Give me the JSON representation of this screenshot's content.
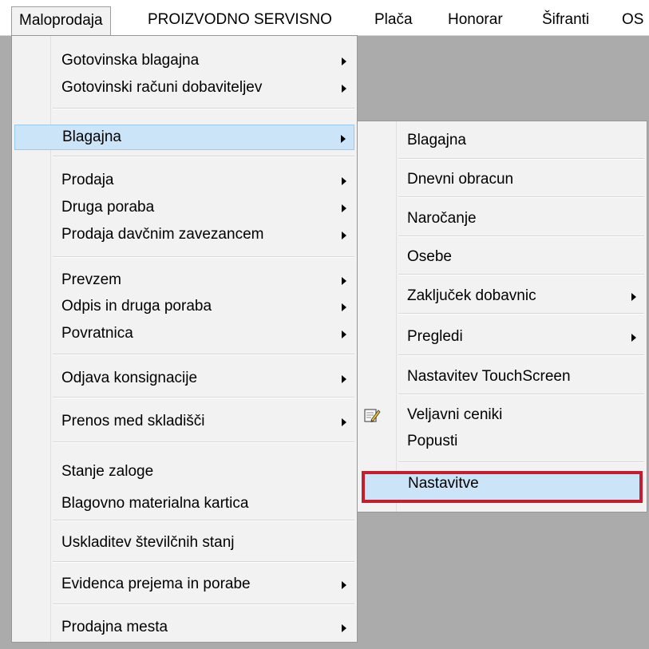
{
  "menubar": {
    "items": [
      {
        "label": "Maloprodaja"
      },
      {
        "label": "PROIZVODNO SERVISNO"
      },
      {
        "label": "Plača"
      },
      {
        "label": "Honorar"
      },
      {
        "label": "Šifranti"
      },
      {
        "label": "OS"
      }
    ]
  },
  "main_menu": {
    "items": [
      {
        "label": "Gotovinska blagajna"
      },
      {
        "label": "Gotovinski računi dobaviteljev"
      },
      {
        "label": "Blagajna"
      },
      {
        "label": "Prodaja"
      },
      {
        "label": "Druga poraba"
      },
      {
        "label": "Prodaja davčnim zavezancem"
      },
      {
        "label": "Prevzem"
      },
      {
        "label": "Odpis in druga poraba"
      },
      {
        "label": "Povratnica"
      },
      {
        "label": "Odjava konsignacije"
      },
      {
        "label": "Prenos med skladišči"
      },
      {
        "label": "Stanje zaloge"
      },
      {
        "label": "Blagovno materialna kartica"
      },
      {
        "label": "Uskladitev številčnih stanj"
      },
      {
        "label": "Evidenca prejema in porabe"
      },
      {
        "label": "Prodajna mesta"
      }
    ]
  },
  "sub_menu": {
    "items": [
      {
        "label": "Blagajna"
      },
      {
        "label": "Dnevni obracun"
      },
      {
        "label": "Naročanje"
      },
      {
        "label": "Osebe"
      },
      {
        "label": "Zaključek dobavnic"
      },
      {
        "label": "Pregledi"
      },
      {
        "label": "Nastavitev TouchScreen"
      },
      {
        "label": "Veljavni ceniki"
      },
      {
        "label": "Popusti"
      },
      {
        "label": "Nastavitve"
      }
    ]
  },
  "icons": {
    "veljavni_ceniki": "edit-document-icon"
  },
  "colors": {
    "highlight": "#cce4f7",
    "highlight_border": "#99c9ef",
    "annotation_outline": "#c21e2e"
  }
}
